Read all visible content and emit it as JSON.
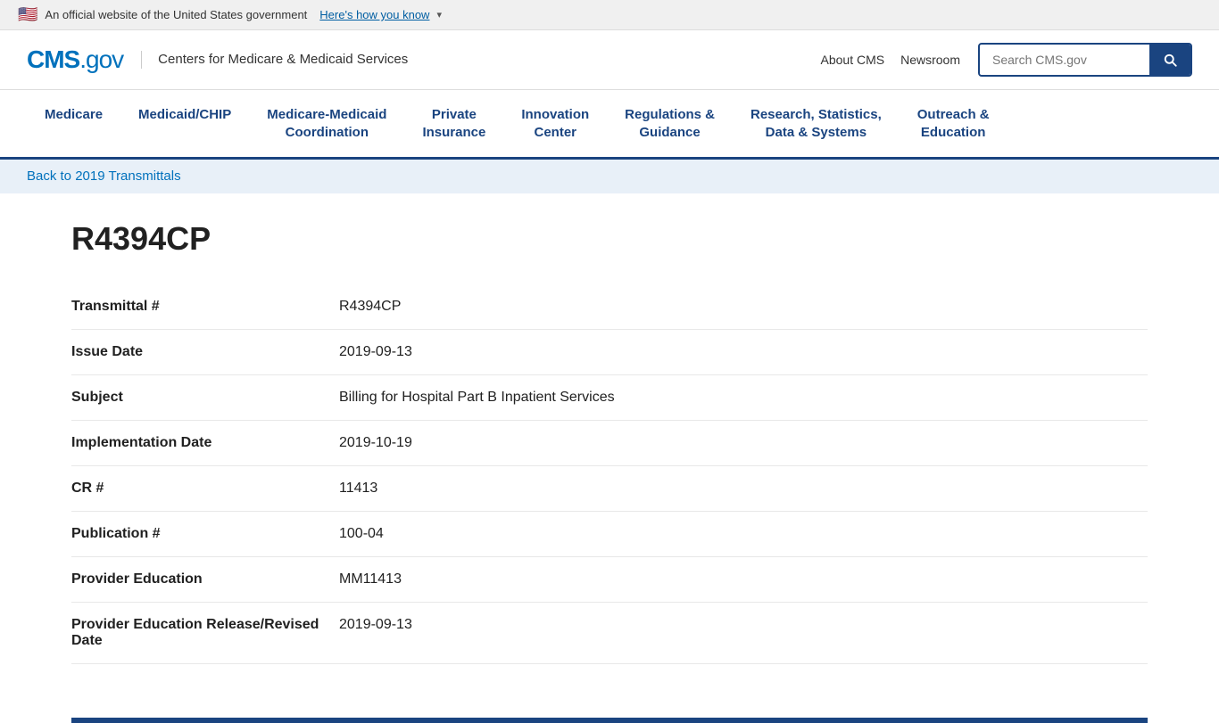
{
  "govBanner": {
    "flagEmoji": "🇺🇸",
    "text": "An official website of the United States government",
    "howToKnow": "Here's how you know",
    "chevron": "▾"
  },
  "header": {
    "logoMain": "CMS",
    "logoDot": ".",
    "logoGov": "gov",
    "agencyName": "Centers for Medicare & Medicaid Services",
    "links": [
      {
        "label": "About CMS"
      },
      {
        "label": "Newsroom"
      }
    ],
    "searchPlaceholder": "Search CMS.gov"
  },
  "nav": {
    "items": [
      {
        "label": "Medicare"
      },
      {
        "label": "Medicaid/CHIP"
      },
      {
        "label": "Medicare-Medicaid\nCoordination"
      },
      {
        "label": "Private\nInsurance"
      },
      {
        "label": "Innovation\nCenter"
      },
      {
        "label": "Regulations &\nGuidance"
      },
      {
        "label": "Research, Statistics,\nData & Systems"
      },
      {
        "label": "Outreach &\nEducation"
      }
    ]
  },
  "breadcrumb": {
    "text": "Back to 2019 Transmittals"
  },
  "pageTitle": "R4394CP",
  "details": {
    "fields": [
      {
        "label": "Transmittal #",
        "value": "R4394CP"
      },
      {
        "label": "Issue Date",
        "value": "2019-09-13"
      },
      {
        "label": "Subject",
        "value": "Billing for Hospital Part B Inpatient Services"
      },
      {
        "label": "Implementation Date",
        "value": "2019-10-19"
      },
      {
        "label": "CR #",
        "value": "11413"
      },
      {
        "label": "Publication #",
        "value": "100-04"
      },
      {
        "label": "Provider Education",
        "value": "MM11413"
      },
      {
        "label": "Provider Education Release/Revised Date",
        "value": "2019-09-13"
      }
    ]
  }
}
